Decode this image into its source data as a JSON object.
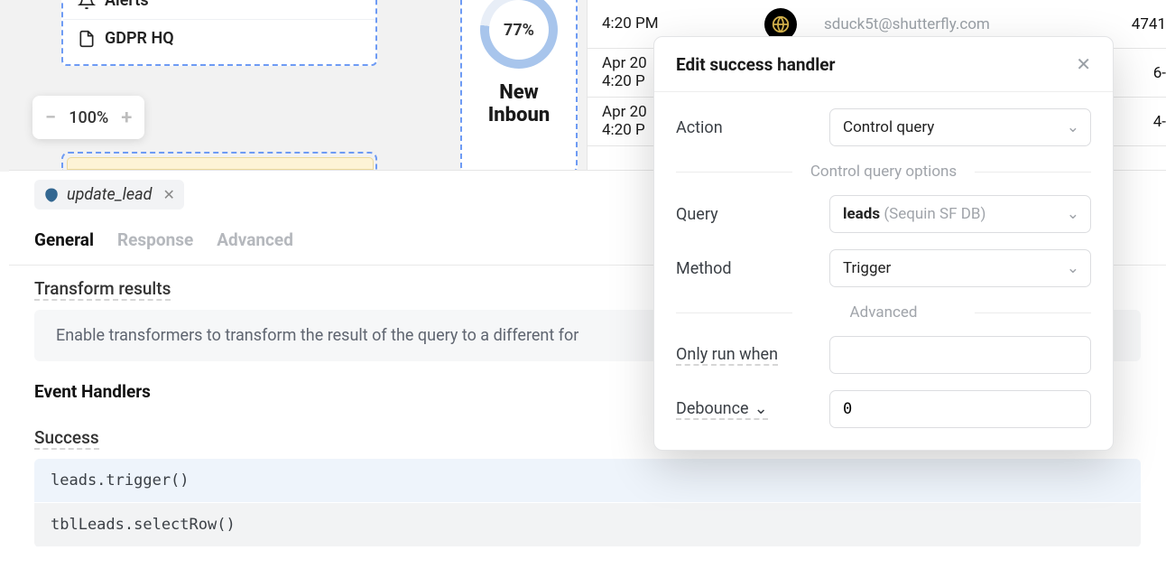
{
  "sidebar": {
    "items": [
      {
        "label": "Alerts",
        "icon": "bell-icon"
      },
      {
        "label": "GDPR HQ",
        "icon": "file-icon"
      }
    ]
  },
  "zoom": {
    "value": "100%"
  },
  "gauge": {
    "percent": "77%",
    "label": "New Inboun"
  },
  "table": {
    "rows": [
      {
        "ts1": "",
        "ts2": "4:20 PM",
        "email": "sduck5t@shutterfly.com",
        "id": "4741"
      },
      {
        "ts1": "Apr 20",
        "ts2": "4:20 P",
        "email": "",
        "id": "6-"
      },
      {
        "ts1": "Apr 20",
        "ts2": "4:20 P",
        "email": "",
        "id": "4-"
      }
    ]
  },
  "editor": {
    "query_name": "update_lead",
    "tabs": {
      "general": "General",
      "response": "Response",
      "advanced": "Advanced"
    },
    "transform": {
      "title": "Transform results",
      "hint": "Enable transformers to transform the result of the query to a different for"
    },
    "event_handlers": {
      "title": "Event Handlers",
      "success_label": "Success",
      "handlers": [
        "leads.trigger()",
        "tblLeads.selectRow()"
      ]
    }
  },
  "popover": {
    "title": "Edit success handler",
    "sections": {
      "control_query": "Control query options",
      "advanced": "Advanced"
    },
    "fields": {
      "action": {
        "label": "Action",
        "value": "Control query"
      },
      "query": {
        "label": "Query",
        "value": "leads",
        "suffix": "(Sequin SF DB)"
      },
      "method": {
        "label": "Method",
        "value": "Trigger"
      },
      "only": {
        "label": "Only run when",
        "value": ""
      },
      "debounce": {
        "label": "Debounce",
        "value": "0"
      }
    }
  }
}
